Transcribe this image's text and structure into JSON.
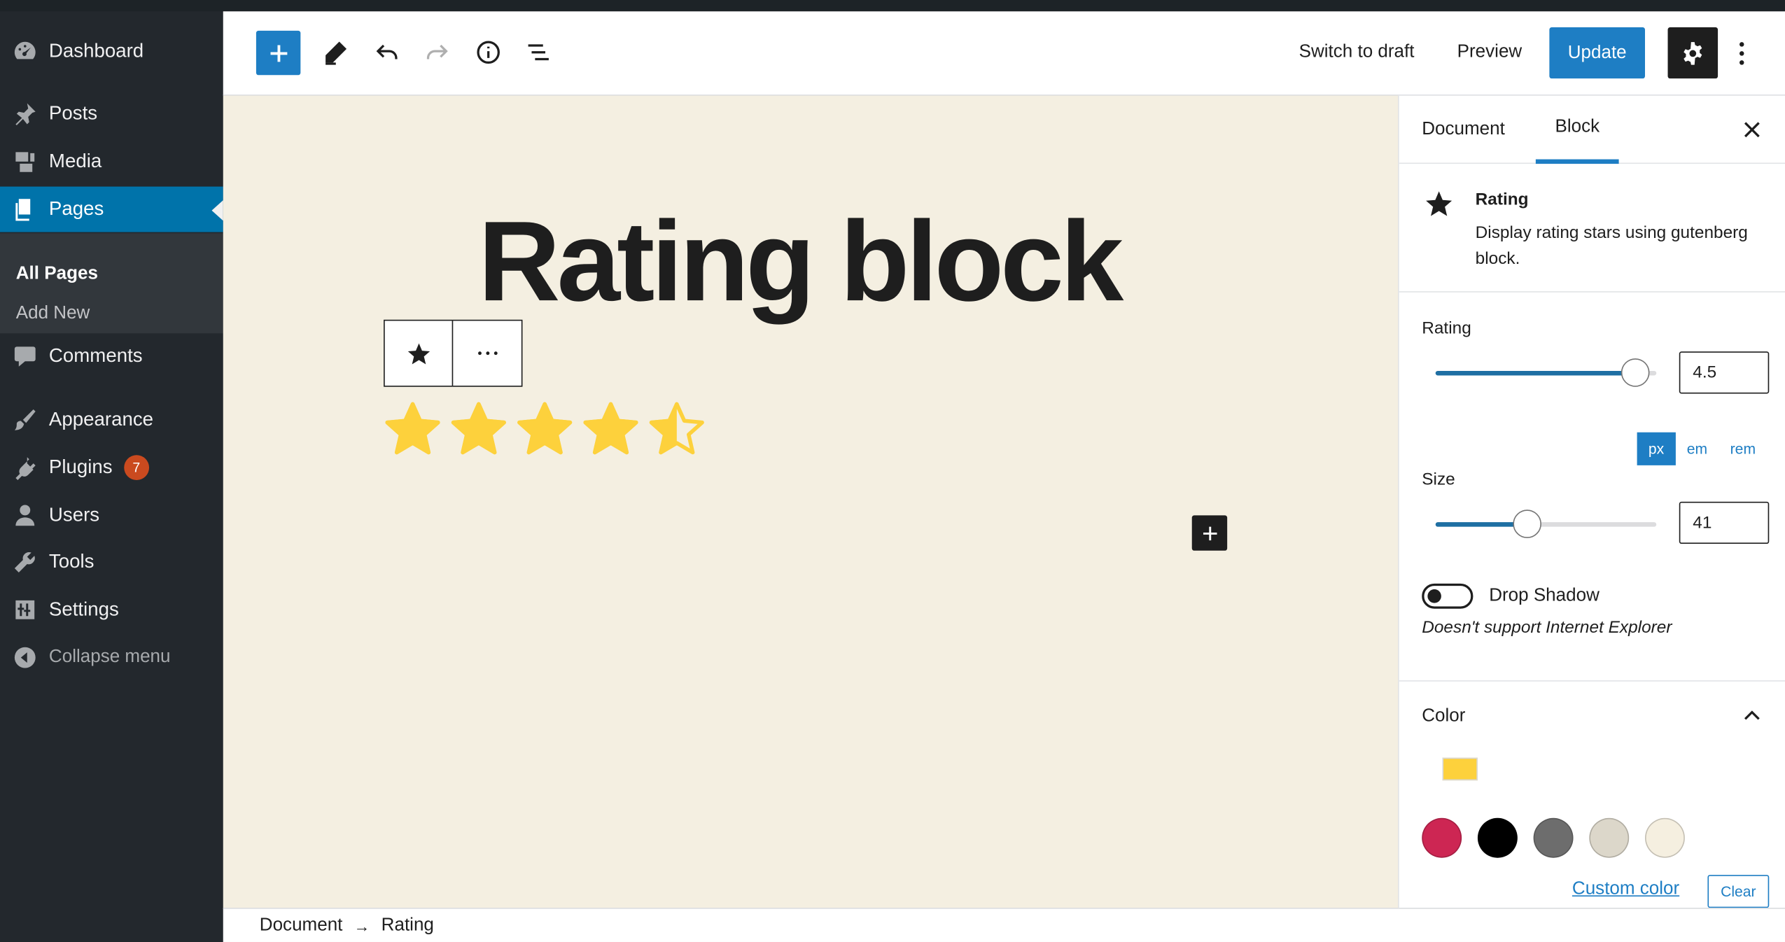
{
  "admin_menu": {
    "items": [
      {
        "label": "Dashboard",
        "icon": "dashboard-icon"
      },
      {
        "label": "Posts",
        "icon": "pin-icon"
      },
      {
        "label": "Media",
        "icon": "media-icon"
      },
      {
        "label": "Pages",
        "icon": "pages-icon",
        "active": true
      },
      {
        "label": "Comments",
        "icon": "comment-icon"
      },
      {
        "label": "Appearance",
        "icon": "brush-icon"
      },
      {
        "label": "Plugins",
        "icon": "plugin-icon",
        "badge": "7"
      },
      {
        "label": "Users",
        "icon": "user-icon"
      },
      {
        "label": "Tools",
        "icon": "wrench-icon"
      },
      {
        "label": "Settings",
        "icon": "sliders-icon"
      }
    ],
    "submenu": [
      "All Pages",
      "Add New"
    ],
    "collapse_label": "Collapse menu"
  },
  "header": {
    "switch_to_draft": "Switch to draft",
    "preview": "Preview",
    "update": "Update"
  },
  "canvas": {
    "title": "Rating block",
    "rating_stars_filled": 4.5,
    "rating_max": 5,
    "star_color": "#fdd13c"
  },
  "sidebar": {
    "tabs": [
      "Document",
      "Block"
    ],
    "active_tab": "Block",
    "block_card": {
      "title": "Rating",
      "description": "Display rating stars using gutenberg block."
    },
    "rating": {
      "label": "Rating",
      "value": "4.5",
      "level": 0.9
    },
    "units": [
      "px",
      "em",
      "rem"
    ],
    "active_unit": "px",
    "size": {
      "label": "Size",
      "value": "41",
      "level": 0.41
    },
    "drop_shadow": {
      "label": "Drop Shadow",
      "help": "Doesn't support Internet Explorer",
      "enabled": false
    },
    "color": {
      "title": "Color",
      "current": "#fdd13c",
      "palette": [
        "#cd2653",
        "#000000",
        "#6d6d6d",
        "#dcd7ca",
        "#f5efe0"
      ],
      "custom_color": "Custom color",
      "clear": "Clear"
    }
  },
  "breadcrumb": [
    "Document",
    "Rating"
  ],
  "colors": {
    "accent": "#1e7ec4",
    "admin_bg": "#23282d",
    "canvas_bg": "#f4efe1"
  }
}
